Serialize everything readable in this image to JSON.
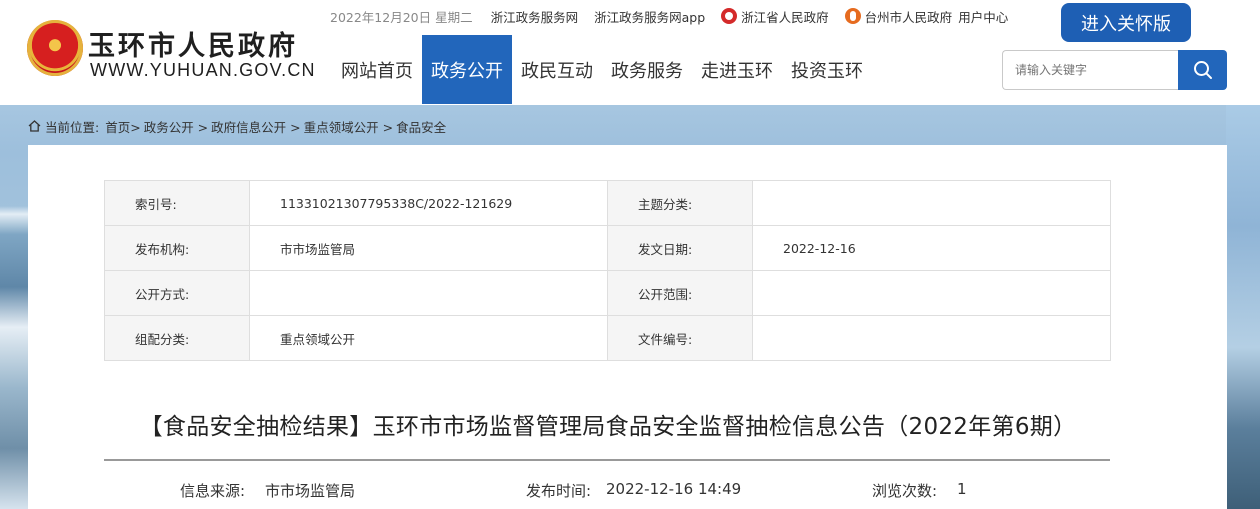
{
  "header": {
    "site_title": "玉环市人民政府",
    "site_url": "WWW.YUHUAN.GOV.CN",
    "date": "2022年12月20日 星期二",
    "top_links": [
      "浙江政务服务网",
      "浙江政务服务网app",
      "浙江省人民政府",
      "台州市人民政府",
      "用户中心"
    ],
    "care_button": "进入关怀版",
    "nav": [
      "网站首页",
      "政务公开",
      "政民互动",
      "政务服务",
      "走进玉环",
      "投资玉环"
    ],
    "nav_active": "政务公开",
    "search_placeholder": "请输入关键字"
  },
  "breadcrumb": {
    "prefix": "当前位置:",
    "items": [
      "首页>",
      "政务公开 >",
      "政府信息公开 >",
      "重点领域公开 >",
      "食品安全"
    ]
  },
  "meta_table": {
    "rows": [
      {
        "l1": "索引号:",
        "v1": "11331021307795338C/2022-121629",
        "l2": "主题分类:",
        "v2": ""
      },
      {
        "l1": "发布机构:",
        "v1": "市市场监管局",
        "l2": "发文日期:",
        "v2": "2022-12-16"
      },
      {
        "l1": "公开方式:",
        "v1": "",
        "l2": "公开范围:",
        "v2": ""
      },
      {
        "l1": "组配分类:",
        "v1": "重点领域公开",
        "l2": "文件编号:",
        "v2": ""
      }
    ]
  },
  "document": {
    "title": "【食品安全抽检结果】玉环市市场监督管理局食品安全监督抽检信息公告（2022年第6期）",
    "source_label": "信息来源:",
    "source_value": "市市场监管局",
    "publish_label": "发布时间:",
    "publish_value": "2022-12-16 14:49",
    "views_label": "浏览次数:",
    "views_value": "1"
  },
  "colors": {
    "primary_blue": "#2266bb",
    "care_button_blue": "#1e5fb4"
  }
}
